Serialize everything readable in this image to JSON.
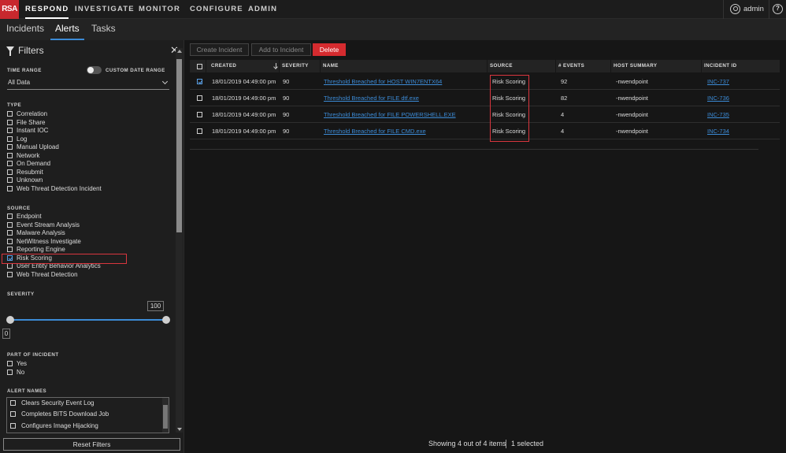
{
  "nav": {
    "logo": "RSA",
    "items": [
      "RESPOND",
      "INVESTIGATE",
      "MONITOR",
      "CONFIGURE",
      "ADMIN"
    ],
    "user": "admin",
    "help": "?"
  },
  "subtabs": [
    "Incidents",
    "Alerts",
    "Tasks"
  ],
  "filters": {
    "title": "Filters",
    "time_range_label": "TIME RANGE",
    "custom_date_label": "CUSTOM DATE RANGE",
    "time_range_value": "All Data",
    "type_label": "TYPE",
    "type_items": [
      "Correlation",
      "File Share",
      "Instant IOC",
      "Log",
      "Manual Upload",
      "Network",
      "On Demand",
      "Resubmit",
      "Unknown",
      "Web Threat Detection Incident"
    ],
    "source_label": "SOURCE",
    "source_items": [
      "Endpoint",
      "Event Stream Analysis",
      "Malware Analysis",
      "NetWitness Investigate",
      "Reporting Engine",
      "Risk Scoring",
      "User Entity Behavior Analytics",
      "Web Threat Detection"
    ],
    "source_checked": "Risk Scoring",
    "severity_label": "SEVERITY",
    "severity_min": "0",
    "severity_max": "100",
    "part_of_incident_label": "PART OF INCIDENT",
    "part_items": [
      "Yes",
      "No"
    ],
    "alert_names_label": "ALERT NAMES",
    "alert_names": [
      "Clears Security Event Log",
      "Completes BITS Download Job",
      "Configures Image Hijacking"
    ],
    "reset_label": "Reset Filters"
  },
  "toolbar": {
    "create_incident": "Create Incident",
    "add_to_incident": "Add to Incident",
    "delete": "Delete"
  },
  "table": {
    "headers": [
      "CREATED",
      "SEVERITY",
      "NAME",
      "SOURCE",
      "# EVENTS",
      "HOST SUMMARY",
      "INCIDENT ID"
    ],
    "rows": [
      {
        "checked": true,
        "created": "18/01/2019 04:49:00 pm",
        "severity": "90",
        "name": "Threshold Breached for HOST WIN7ENTX64",
        "source": "Risk Scoring",
        "events": "92",
        "host": "-nwendpoint",
        "incident": "INC-737"
      },
      {
        "checked": false,
        "created": "18/01/2019 04:49:00 pm",
        "severity": "90",
        "name": "Threshold Breached for FILE dtf.exe",
        "source": "Risk Scoring",
        "events": "82",
        "host": "-nwendpoint",
        "incident": "INC-736"
      },
      {
        "checked": false,
        "created": "18/01/2019 04:49:00 pm",
        "severity": "90",
        "name": "Threshold Breached for FILE POWERSHELL.EXE",
        "source": "Risk Scoring",
        "events": "4",
        "host": "-nwendpoint",
        "incident": "INC-735"
      },
      {
        "checked": false,
        "created": "18/01/2019 04:49:00 pm",
        "severity": "90",
        "name": "Threshold Breached for FILE CMD.exe",
        "source": "Risk Scoring",
        "events": "4",
        "host": "-nwendpoint",
        "incident": "INC-734"
      }
    ]
  },
  "footer": {
    "showing": "Showing 4 out of 4 items",
    "selected": "1 selected"
  },
  "colors": {
    "accent": "#3c8bd6",
    "danger": "#d52b2f",
    "background": "#161616"
  }
}
